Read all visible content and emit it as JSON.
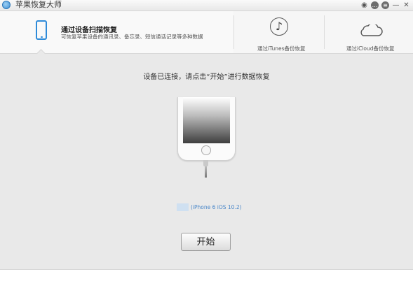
{
  "window": {
    "title": "苹果恢复大师",
    "controls": [
      "weibo-icon",
      "chat-icon",
      "menu-icon",
      "minimize-icon",
      "close-icon"
    ]
  },
  "options": {
    "active": {
      "title": "通过设备扫描恢复",
      "description": "可恢复苹果设备的通讯录、备忘录、短信通话记录等多种数据",
      "icon": "phone-icon"
    },
    "itunes": {
      "label": "通过iTunes备份恢复",
      "icon": "music-note-icon"
    },
    "icloud": {
      "label": "通过iCloud备份恢复",
      "icon": "cloud-icon"
    }
  },
  "main": {
    "prompt": "设备已连接，请点击“开始”进行数据恢复",
    "device_model": "(iPhone 6 iOS 10.2)",
    "start_label": "开始"
  },
  "colors": {
    "accent": "#2f8bd9",
    "link": "#4a87c9",
    "background": "#e9e9e9"
  }
}
